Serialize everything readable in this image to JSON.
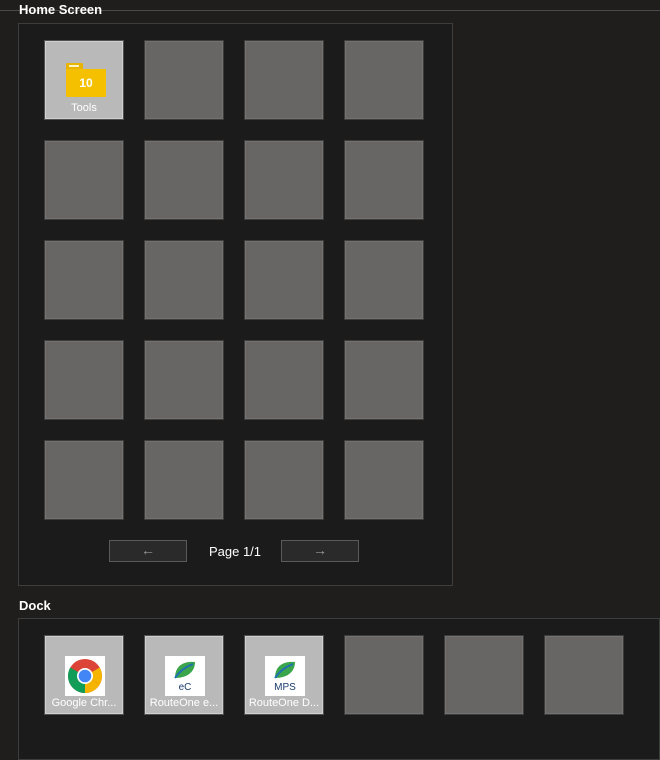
{
  "home": {
    "title": "Home Screen",
    "folder": {
      "label": "Tools",
      "count": "10",
      "icon": "folder-icon"
    },
    "pagination": {
      "prev_label": "←",
      "next_label": "→",
      "page_text": "Page 1/1"
    }
  },
  "dock": {
    "title": "Dock",
    "apps": [
      {
        "label": "Google Chr...",
        "icon": "chrome-icon"
      },
      {
        "label": "RouteOne e...",
        "icon": "routeone-ec-icon",
        "icon_text": "eC"
      },
      {
        "label": "RouteOne D...",
        "icon": "routeone-mps-icon",
        "icon_text": "MPS"
      }
    ]
  },
  "colors": {
    "background": "#1f1e1d",
    "empty_slot": "#676665",
    "filled_slot": "#b9b9b9",
    "folder": "#f5c000"
  }
}
